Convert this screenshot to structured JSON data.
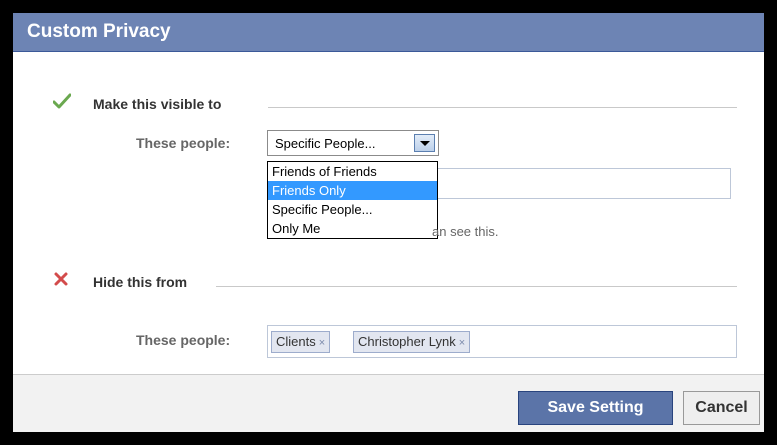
{
  "dialog": {
    "title": "Custom Privacy"
  },
  "visible_section": {
    "heading": "Make this visible to",
    "icon": "check-icon",
    "row_label": "These people:",
    "select_value": "Specific People...",
    "options": [
      "Friends of Friends",
      "Friends Only",
      "Specific People...",
      "Only Me"
    ],
    "highlighted_option": "Friends Only",
    "hint_fragment": "an see this."
  },
  "hide_section": {
    "heading": "Hide this from",
    "icon": "red-x-icon",
    "row_label": "These people:",
    "tokens": [
      "Clients",
      "Christopher Lynk"
    ],
    "token_remove": "×"
  },
  "footer": {
    "save_label": "Save Setting",
    "cancel_label": "Cancel"
  },
  "colors": {
    "titlebar": "#6d84b4",
    "primary_button": "#5b74a8",
    "highlight": "#3399ff"
  }
}
